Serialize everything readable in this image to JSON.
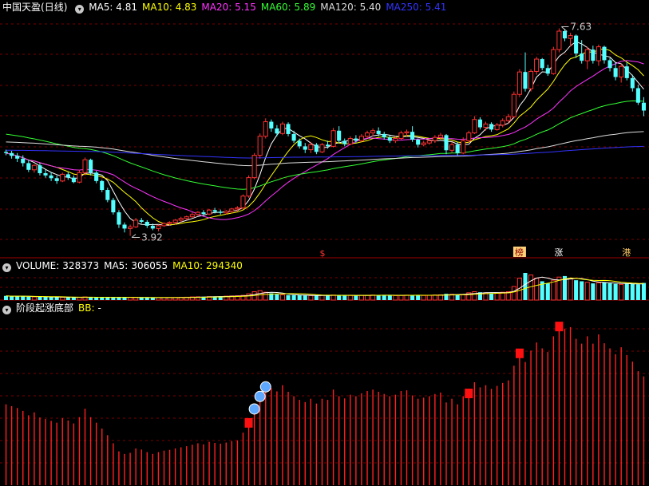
{
  "header": {
    "stock": "中国天盈",
    "period": "(日线)",
    "ma_labels": [
      {
        "name": "MA5",
        "value": "4.81",
        "color": "#ffffff"
      },
      {
        "name": "MA10",
        "value": "4.83",
        "color": "#ffff00"
      },
      {
        "name": "MA20",
        "value": "5.15",
        "color": "#ff33ff"
      },
      {
        "name": "MA60",
        "value": "5.89",
        "color": "#33ff33"
      },
      {
        "name": "MA120",
        "value": "5.40",
        "color": "#dddddd"
      },
      {
        "name": "MA250",
        "value": "5.41",
        "color": "#3333ff"
      }
    ]
  },
  "volume_header": {
    "label": "VOLUME:",
    "value": "328373",
    "ma5_label": "MA5:",
    "ma5": "306055",
    "ma10_label": "MA10:",
    "ma10": "294340"
  },
  "indicator_header": {
    "name": "阶段起涨底部",
    "bb_label": "BB:",
    "bb_value": "-"
  },
  "annotations": {
    "high": "7.63",
    "low": "3.92"
  },
  "event_tags": [
    {
      "text": "$",
      "color": "#ff3333"
    },
    {
      "text": "榜",
      "color": "#ffcc66"
    },
    {
      "text": "涨",
      "color": "#ffffff"
    },
    {
      "text": "港",
      "color": "#ffcc66"
    }
  ],
  "colors": {
    "up": "#ff3232",
    "down": "#54ffff",
    "bg": "#000000",
    "grid": "#7a0000",
    "ma5": "#ffffff",
    "ma10": "#ffff00",
    "ma20": "#ff33ff",
    "ma60": "#33ff33",
    "ma120": "#dddddd",
    "ma250": "#3333ff",
    "volume_ma5": "#ffffff",
    "volume_ma10": "#ffff00"
  },
  "chart_data": [
    {
      "type": "candlestick",
      "panel": "price",
      "ohlc": [
        [
          5.42,
          5.46,
          5.36,
          5.4
        ],
        [
          5.4,
          5.44,
          5.3,
          5.35
        ],
        [
          5.35,
          5.4,
          5.24,
          5.3
        ],
        [
          5.3,
          5.36,
          5.16,
          5.22
        ],
        [
          5.22,
          5.28,
          5.06,
          5.1
        ],
        [
          5.1,
          5.2,
          5.05,
          5.18
        ],
        [
          5.18,
          5.22,
          5.0,
          5.04
        ],
        [
          5.04,
          5.1,
          4.96,
          5.0
        ],
        [
          5.0,
          5.06,
          4.9,
          4.95
        ],
        [
          4.95,
          5.0,
          4.85,
          4.9
        ],
        [
          4.9,
          5.05,
          4.88,
          5.02
        ],
        [
          5.02,
          5.06,
          4.92,
          4.96
        ],
        [
          4.96,
          5.0,
          4.86,
          4.88
        ],
        [
          4.88,
          5.1,
          4.86,
          5.05
        ],
        [
          5.05,
          5.32,
          5.0,
          5.28
        ],
        [
          5.28,
          5.3,
          5.0,
          5.05
        ],
        [
          5.05,
          5.08,
          4.86,
          4.9
        ],
        [
          4.9,
          4.92,
          4.7,
          4.74
        ],
        [
          4.74,
          4.78,
          4.52,
          4.56
        ],
        [
          4.56,
          4.6,
          4.3,
          4.34
        ],
        [
          4.34,
          4.38,
          4.06,
          4.12
        ],
        [
          4.12,
          4.16,
          3.98,
          4.05
        ],
        [
          4.05,
          4.12,
          3.92,
          4.08
        ],
        [
          4.08,
          4.24,
          4.06,
          4.2
        ],
        [
          4.2,
          4.24,
          4.14,
          4.17
        ],
        [
          4.17,
          4.2,
          4.06,
          4.1
        ],
        [
          4.1,
          4.14,
          4.02,
          4.05
        ],
        [
          4.05,
          4.12,
          4.0,
          4.1
        ],
        [
          4.1,
          4.16,
          4.08,
          4.14
        ],
        [
          4.14,
          4.18,
          4.1,
          4.16
        ],
        [
          4.16,
          4.22,
          4.12,
          4.2
        ],
        [
          4.2,
          4.26,
          4.16,
          4.23
        ],
        [
          4.23,
          4.28,
          4.2,
          4.26
        ],
        [
          4.26,
          4.34,
          4.24,
          4.3
        ],
        [
          4.3,
          4.36,
          4.28,
          4.34
        ],
        [
          4.34,
          4.38,
          4.28,
          4.31
        ],
        [
          4.31,
          4.4,
          4.29,
          4.38
        ],
        [
          4.38,
          4.42,
          4.32,
          4.35
        ],
        [
          4.35,
          4.39,
          4.3,
          4.33
        ],
        [
          4.33,
          4.38,
          4.3,
          4.36
        ],
        [
          4.36,
          4.42,
          4.32,
          4.4
        ],
        [
          4.4,
          4.45,
          4.35,
          4.42
        ],
        [
          4.42,
          4.66,
          4.4,
          4.63
        ],
        [
          4.63,
          5.0,
          4.6,
          4.96
        ],
        [
          4.96,
          5.4,
          4.93,
          5.36
        ],
        [
          5.36,
          5.75,
          5.3,
          5.7
        ],
        [
          5.7,
          6.02,
          5.66,
          5.96
        ],
        [
          5.96,
          6.0,
          5.78,
          5.84
        ],
        [
          5.84,
          5.9,
          5.7,
          5.75
        ],
        [
          5.75,
          5.96,
          5.72,
          5.92
        ],
        [
          5.92,
          5.95,
          5.7,
          5.74
        ],
        [
          5.74,
          5.8,
          5.58,
          5.62
        ],
        [
          5.62,
          5.66,
          5.48,
          5.52
        ],
        [
          5.52,
          5.58,
          5.4,
          5.46
        ],
        [
          5.46,
          5.6,
          5.4,
          5.55
        ],
        [
          5.55,
          5.58,
          5.38,
          5.42
        ],
        [
          5.42,
          5.58,
          5.4,
          5.55
        ],
        [
          5.55,
          5.62,
          5.48,
          5.52
        ],
        [
          5.52,
          5.85,
          5.5,
          5.8
        ],
        [
          5.8,
          5.88,
          5.58,
          5.62
        ],
        [
          5.62,
          5.66,
          5.52,
          5.56
        ],
        [
          5.56,
          5.7,
          5.54,
          5.66
        ],
        [
          5.66,
          5.72,
          5.58,
          5.62
        ],
        [
          5.62,
          5.74,
          5.6,
          5.7
        ],
        [
          5.7,
          5.8,
          5.66,
          5.76
        ],
        [
          5.76,
          5.84,
          5.7,
          5.8
        ],
        [
          5.8,
          5.86,
          5.7,
          5.74
        ],
        [
          5.74,
          5.78,
          5.64,
          5.68
        ],
        [
          5.68,
          5.72,
          5.58,
          5.62
        ],
        [
          5.62,
          5.7,
          5.58,
          5.66
        ],
        [
          5.66,
          5.8,
          5.64,
          5.76
        ],
        [
          5.76,
          5.82,
          5.7,
          5.78
        ],
        [
          5.78,
          5.88,
          5.6,
          5.64
        ],
        [
          5.64,
          5.66,
          5.5,
          5.55
        ],
        [
          5.55,
          5.62,
          5.52,
          5.58
        ],
        [
          5.58,
          5.66,
          5.55,
          5.62
        ],
        [
          5.62,
          5.72,
          5.58,
          5.68
        ],
        [
          5.68,
          5.76,
          5.64,
          5.72
        ],
        [
          5.72,
          5.74,
          5.38,
          5.45
        ],
        [
          5.45,
          5.6,
          5.4,
          5.55
        ],
        [
          5.55,
          5.6,
          5.36,
          5.4
        ],
        [
          5.4,
          5.68,
          5.38,
          5.62
        ],
        [
          5.62,
          5.8,
          5.58,
          5.76
        ],
        [
          5.76,
          6.06,
          5.74,
          6.0
        ],
        [
          6.0,
          6.04,
          5.82,
          5.86
        ],
        [
          5.86,
          5.96,
          5.8,
          5.92
        ],
        [
          5.92,
          5.95,
          5.78,
          5.82
        ],
        [
          5.82,
          5.94,
          5.8,
          5.9
        ],
        [
          5.9,
          6.02,
          5.86,
          5.98
        ],
        [
          5.98,
          6.1,
          5.92,
          6.05
        ],
        [
          6.05,
          6.5,
          6.02,
          6.45
        ],
        [
          6.45,
          6.9,
          6.4,
          6.85
        ],
        [
          6.85,
          7.2,
          6.5,
          6.55
        ],
        [
          6.55,
          6.9,
          6.5,
          6.86
        ],
        [
          6.86,
          7.12,
          6.8,
          7.08
        ],
        [
          7.08,
          7.1,
          6.88,
          6.92
        ],
        [
          6.92,
          6.98,
          6.78,
          6.82
        ],
        [
          6.82,
          7.3,
          6.8,
          7.25
        ],
        [
          7.25,
          7.63,
          7.2,
          7.58
        ],
        [
          7.58,
          7.62,
          7.4,
          7.45
        ],
        [
          7.45,
          7.55,
          7.3,
          7.5
        ],
        [
          7.5,
          7.52,
          7.1,
          7.18
        ],
        [
          7.18,
          7.42,
          7.0,
          7.05
        ],
        [
          7.05,
          7.3,
          6.9,
          7.25
        ],
        [
          7.25,
          7.32,
          7.0,
          7.05
        ],
        [
          7.05,
          7.34,
          6.96,
          7.3
        ],
        [
          7.3,
          7.32,
          7.0,
          7.06
        ],
        [
          7.06,
          7.1,
          6.86,
          6.92
        ],
        [
          6.92,
          7.02,
          6.7,
          6.76
        ],
        [
          6.76,
          7.0,
          6.66,
          6.95
        ],
        [
          6.95,
          7.02,
          6.7,
          6.74
        ],
        [
          6.74,
          6.8,
          6.5,
          6.56
        ],
        [
          6.56,
          6.62,
          6.26,
          6.3
        ],
        [
          6.3,
          6.4,
          6.06,
          6.16
        ]
      ],
      "moving_averages": [
        "MA5",
        "MA10",
        "MA20",
        "MA60",
        "MA120",
        "MA250"
      ],
      "annotations": [
        "7.63 (high)",
        "3.92 (low)"
      ]
    },
    {
      "type": "bar",
      "panel": "volume",
      "values": [
        80000,
        70000,
        75000,
        72000,
        65000,
        60000,
        62000,
        58000,
        56000,
        54000,
        52000,
        50000,
        49000,
        52000,
        60000,
        55000,
        53000,
        50000,
        48000,
        52000,
        56000,
        54000,
        50000,
        48000,
        46000,
        45000,
        44000,
        46000,
        47000,
        48000,
        50000,
        52000,
        55000,
        60000,
        62000,
        64000,
        66000,
        70000,
        72000,
        75000,
        78000,
        82000,
        90000,
        120000,
        160000,
        180000,
        150000,
        130000,
        110000,
        100000,
        95000,
        92000,
        90000,
        88000,
        86000,
        84000,
        90000,
        92000,
        96000,
        94000,
        90000,
        88000,
        86000,
        90000,
        92000,
        96000,
        98000,
        92000,
        88000,
        86000,
        90000,
        94000,
        98000,
        92000,
        88000,
        90000,
        96000,
        100000,
        120000,
        110000,
        100000,
        110000,
        140000,
        160000,
        150000,
        140000,
        130000,
        140000,
        150000,
        160000,
        260000,
        420000,
        520000,
        480000,
        420000,
        360000,
        320000,
        380000,
        440000,
        460000,
        420000,
        380000,
        360000,
        340000,
        320000,
        330000,
        340000,
        320000,
        310000,
        300000,
        320000,
        310000,
        300000,
        328373
      ]
    },
    {
      "type": "bar",
      "panel": "indicator",
      "name": "阶段起涨底部",
      "values": [
        5.4,
        5.35,
        5.3,
        5.22,
        5.1,
        5.18,
        5.04,
        5.0,
        4.95,
        4.9,
        5.02,
        4.96,
        4.88,
        5.05,
        5.28,
        5.05,
        4.9,
        4.74,
        4.56,
        4.34,
        4.12,
        4.05,
        4.08,
        4.2,
        4.17,
        4.1,
        4.05,
        4.1,
        4.14,
        4.16,
        4.2,
        4.23,
        4.26,
        4.3,
        4.34,
        4.31,
        4.38,
        4.35,
        4.33,
        4.36,
        4.4,
        4.42,
        4.63,
        4.96,
        5.36,
        5.7,
        5.96,
        5.84,
        5.75,
        5.92,
        5.74,
        5.62,
        5.52,
        5.46,
        5.55,
        5.42,
        5.55,
        5.52,
        5.8,
        5.62,
        5.56,
        5.66,
        5.62,
        5.7,
        5.76,
        5.8,
        5.74,
        5.68,
        5.62,
        5.66,
        5.76,
        5.78,
        5.64,
        5.55,
        5.58,
        5.62,
        5.68,
        5.72,
        5.45,
        5.55,
        5.4,
        5.62,
        5.76,
        6.0,
        5.86,
        5.92,
        5.82,
        5.9,
        5.98,
        6.05,
        6.45,
        6.85,
        6.55,
        6.86,
        7.08,
        6.92,
        6.82,
        7.25,
        7.58,
        7.45,
        7.5,
        7.18,
        7.05,
        7.25,
        7.05,
        7.3,
        7.06,
        6.92,
        6.76,
        6.95,
        6.74,
        6.56,
        6.3,
        6.16
      ],
      "markers": [
        {
          "index": 43,
          "kind": "red-square"
        },
        {
          "index": 44,
          "kind": "blue-circle"
        },
        {
          "index": 45,
          "kind": "blue-circle"
        },
        {
          "index": 46,
          "kind": "blue-circle"
        },
        {
          "index": 82,
          "kind": "red-square"
        },
        {
          "index": 91,
          "kind": "red-square"
        },
        {
          "index": 98,
          "kind": "red-square"
        }
      ]
    }
  ]
}
